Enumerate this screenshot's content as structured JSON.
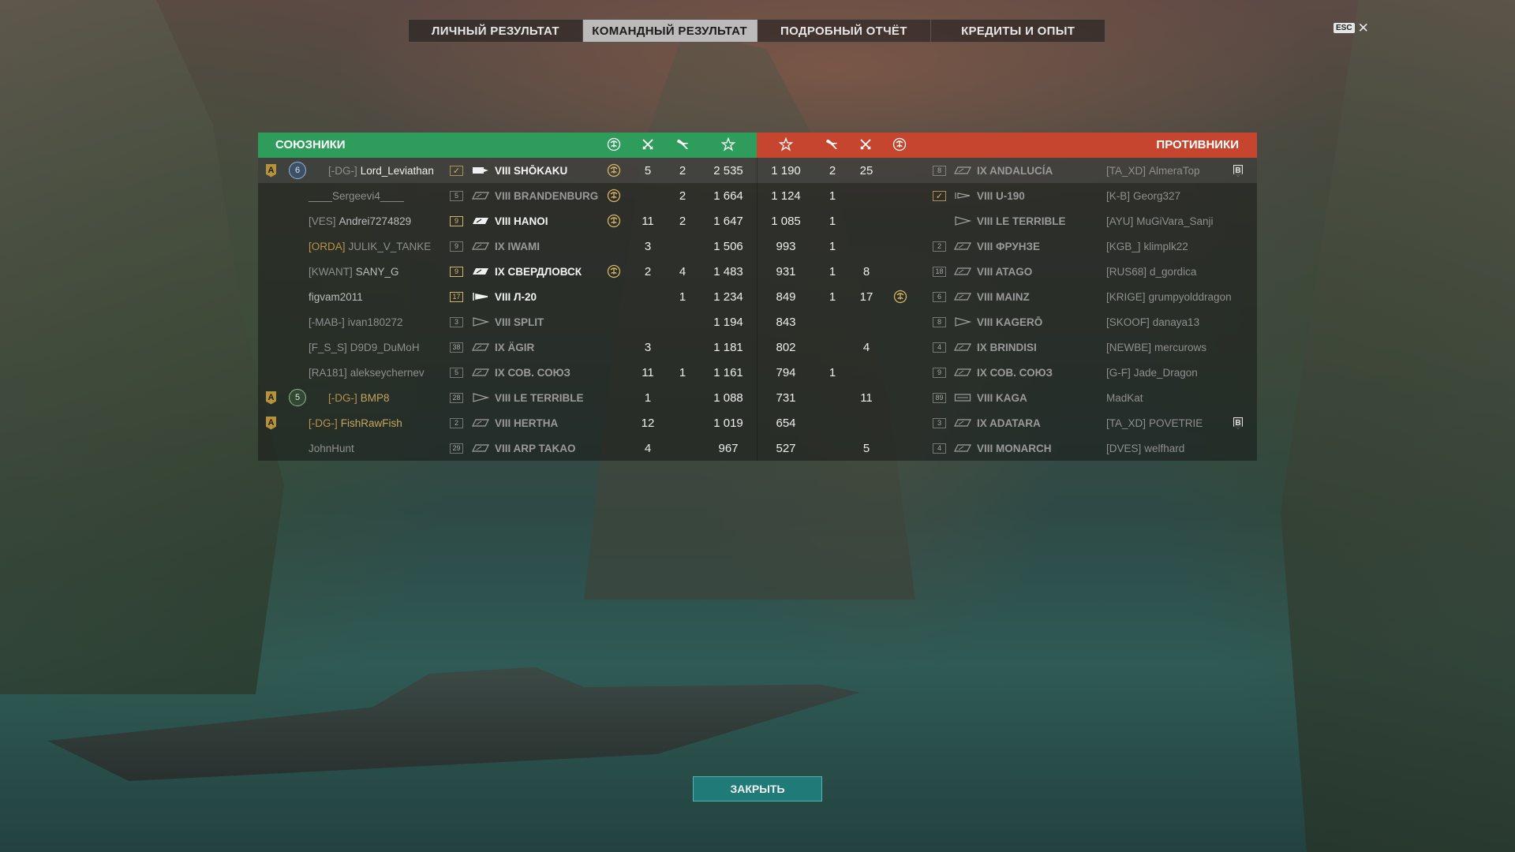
{
  "tabs": [
    {
      "label": "ЛИЧНЫЙ РЕЗУЛЬТАТ",
      "active": false
    },
    {
      "label": "КОМАНДНЫЙ РЕЗУЛЬТАТ",
      "active": true
    },
    {
      "label": "ПОДРОБНЫЙ ОТЧЁТ",
      "active": false
    },
    {
      "label": "КРЕДИТЫ И ОПЫТ",
      "active": false
    }
  ],
  "esc": {
    "key_label": "ESC",
    "close_symbol": "✕"
  },
  "allies_header": "СОЮЗНИКИ",
  "enemies_header": "ПРОТИВНИКИ",
  "header_icons": [
    "kraken-icon",
    "crossed-swords-icon",
    "plane-icon",
    "star-icon"
  ],
  "close_button": "ЗАКРЫТЬ",
  "allies": [
    {
      "badge": "A",
      "rank": "6",
      "rank_color": "blue",
      "clan": "[-DG-]",
      "name": "Lord_Leviathan",
      "name_style": "bright",
      "lvl": "✓",
      "lvl_style": "check",
      "ship_icon": "carrier-filled",
      "ship": "VIII SHŌKAKU",
      "ship_style": "bright",
      "kraken": true,
      "kills": "5",
      "planes": "2",
      "score": "2 535"
    },
    {
      "badge": "",
      "rank": "",
      "rank_color": "",
      "clan": "",
      "name": "____Sergeevi4____",
      "name_style": "dim",
      "lvl": "5",
      "lvl_style": "",
      "ship_icon": "bb-outline",
      "ship": "VIII BRANDENBURG",
      "ship_style": "dim",
      "kraken": true,
      "kills": "",
      "planes": "2",
      "score": "1 664"
    },
    {
      "badge": "",
      "rank": "",
      "rank_color": "",
      "clan": "[VES]",
      "name": "Andrei7274829",
      "name_style": "",
      "lvl": "9",
      "lvl_style": "hl",
      "ship_icon": "bb-filled",
      "ship": "VIII HANOI",
      "ship_style": "bright",
      "kraken": true,
      "kills": "11",
      "planes": "2",
      "score": "1 647"
    },
    {
      "badge": "",
      "rank": "",
      "rank_color": "",
      "clan": "[ORDA]",
      "clan_style": "gold",
      "name": "JULIK_V_TANKE",
      "name_style": "dim",
      "lvl": "9",
      "lvl_style": "",
      "ship_icon": "bb-outline",
      "ship": "IX IWAMI",
      "ship_style": "dim",
      "kraken": false,
      "kills": "3",
      "planes": "",
      "score": "1 506"
    },
    {
      "badge": "",
      "rank": "",
      "rank_color": "",
      "clan": "[KWANT]",
      "name": "SANY_G",
      "name_style": "",
      "lvl": "9",
      "lvl_style": "hl",
      "ship_icon": "bb-filled",
      "ship": "IX СВЕРДЛОВСК",
      "ship_style": "bright",
      "kraken": true,
      "kills": "2",
      "planes": "4",
      "score": "1 483"
    },
    {
      "badge": "",
      "rank": "",
      "rank_color": "",
      "clan": "",
      "name": "figvam2011",
      "name_style": "",
      "lvl": "17",
      "lvl_style": "hl",
      "ship_icon": "dd-filled",
      "ship": "VIII Л-20",
      "ship_style": "bright",
      "kraken": false,
      "kills": "",
      "planes": "1",
      "score": "1 234"
    },
    {
      "badge": "",
      "rank": "",
      "rank_color": "",
      "clan": "[-MAB-]",
      "name": "ivan180272",
      "name_style": "dim",
      "lvl": "3",
      "lvl_style": "",
      "ship_icon": "dd-outline",
      "ship": "VIII SPLIT",
      "ship_style": "dim",
      "kraken": false,
      "kills": "",
      "planes": "",
      "score": "1 194"
    },
    {
      "badge": "",
      "rank": "",
      "rank_color": "",
      "clan": "[F_S_S]",
      "name": "D9D9_DuMoH",
      "name_style": "dim",
      "lvl": "38",
      "lvl_style": "",
      "ship_icon": "bb-outline",
      "ship": "IX ÄGIR",
      "ship_style": "dim",
      "kraken": false,
      "kills": "3",
      "planes": "",
      "score": "1 181"
    },
    {
      "badge": "",
      "rank": "",
      "rank_color": "",
      "clan": "[RA181]",
      "name": "alekseychernev",
      "name_style": "dim",
      "lvl": "5",
      "lvl_style": "",
      "ship_icon": "bb-outline",
      "ship": "IX СОВ. СОЮЗ",
      "ship_style": "dim",
      "kraken": false,
      "kills": "11",
      "planes": "1",
      "score": "1 161"
    },
    {
      "badge": "A",
      "rank": "5",
      "rank_color": "green",
      "clan": "[-DG-]",
      "clan_style": "gold",
      "name": "BMP8",
      "name_style": "gold",
      "lvl": "28",
      "lvl_style": "",
      "ship_icon": "dd-outline",
      "ship": "VIII LE TERRIBLE",
      "ship_style": "dim",
      "kraken": false,
      "kills": "1",
      "planes": "",
      "score": "1 088"
    },
    {
      "badge": "A",
      "rank": "",
      "rank_color": "",
      "clan": "[-DG-]",
      "clan_style": "gold",
      "name": "FishRawFish",
      "name_style": "gold",
      "lvl": "2",
      "lvl_style": "",
      "ship_icon": "bb-outline",
      "ship": "VIII HERTHA",
      "ship_style": "dim",
      "kraken": false,
      "kills": "12",
      "planes": "",
      "score": "1 019"
    },
    {
      "badge": "",
      "rank": "",
      "rank_color": "",
      "clan": "",
      "name": "JohnHunt",
      "name_style": "dim",
      "lvl": "29",
      "lvl_style": "",
      "ship_icon": "bb-outline",
      "ship": "VIII ARP TAKAO",
      "ship_style": "dim",
      "kraken": false,
      "kills": "4",
      "planes": "",
      "score": "967"
    }
  ],
  "enemies": [
    {
      "score": "1 190",
      "planes": "2",
      "kills": "25",
      "kraken": false,
      "lvl": "8",
      "ship_icon": "bb-outline",
      "ship": "IX ANDALUCÍA",
      "clan": "[TA_XD]",
      "name": "AlmeraTop",
      "b_badge": true
    },
    {
      "score": "1 124",
      "planes": "1",
      "kills": "",
      "kraken": false,
      "lvl": "✓",
      "lvl_style": "check",
      "ship_icon": "sub-outline",
      "ship": "VIII U-190",
      "clan": "[K-B]",
      "name": "Georg327",
      "b_badge": false
    },
    {
      "score": "1 085",
      "planes": "1",
      "kills": "",
      "kraken": false,
      "lvl": "",
      "ship_icon": "dd-outline",
      "ship": "VIII LE TERRIBLE",
      "clan": "[AYU]",
      "name": "MuGiVara_Sanji",
      "b_badge": false
    },
    {
      "score": "993",
      "planes": "1",
      "kills": "",
      "kraken": false,
      "lvl": "2",
      "ship_icon": "bb-outline",
      "ship": "VIII ФРУНЗЕ",
      "clan": "[KGB_]",
      "name": "klimplk22",
      "b_badge": false
    },
    {
      "score": "931",
      "planes": "1",
      "kills": "8",
      "kraken": false,
      "lvl": "18",
      "ship_icon": "bb-outline",
      "ship": "VIII ATAGO",
      "clan": "[RUS68]",
      "name": "d_gordica",
      "b_badge": false
    },
    {
      "score": "849",
      "planes": "1",
      "kills": "17",
      "kraken": true,
      "lvl": "6",
      "ship_icon": "bb-outline",
      "ship": "VIII MAINZ",
      "clan": "[KRIGE]",
      "name": "grumpyolddragon",
      "b_badge": false
    },
    {
      "score": "843",
      "planes": "",
      "kills": "",
      "kraken": false,
      "lvl": "8",
      "ship_icon": "dd-outline",
      "ship": "VIII KAGERŌ",
      "clan": "[SKOOF]",
      "name": "danaya13",
      "b_badge": false
    },
    {
      "score": "802",
      "planes": "",
      "kills": "4",
      "kraken": false,
      "lvl": "4",
      "ship_icon": "bb-outline",
      "ship": "IX BRINDISI",
      "clan": "[NEWBE]",
      "name": "mercurows",
      "b_badge": false
    },
    {
      "score": "794",
      "planes": "1",
      "kills": "",
      "kraken": false,
      "lvl": "9",
      "ship_icon": "bb-outline",
      "ship": "IX СОВ. СОЮЗ",
      "clan": "[G-F]",
      "name": "Jade_Dragon",
      "b_badge": false
    },
    {
      "score": "731",
      "planes": "",
      "kills": "11",
      "kraken": false,
      "lvl": "89",
      "ship_icon": "carrier-outline",
      "ship": "VIII KAGA",
      "clan": "",
      "name": "MadKat",
      "b_badge": false
    },
    {
      "score": "654",
      "planes": "",
      "kills": "",
      "kraken": false,
      "lvl": "3",
      "ship_icon": "bb-outline",
      "ship": "IX ADATARA",
      "clan": "[TA_XD]",
      "name": "POVETRIE",
      "b_badge": true
    },
    {
      "score": "527",
      "planes": "",
      "kills": "5",
      "kraken": false,
      "lvl": "4",
      "ship_icon": "bb-outline",
      "ship": "VIII MONARCH",
      "clan": "[DVES]",
      "name": "welfhard",
      "b_badge": false
    }
  ]
}
